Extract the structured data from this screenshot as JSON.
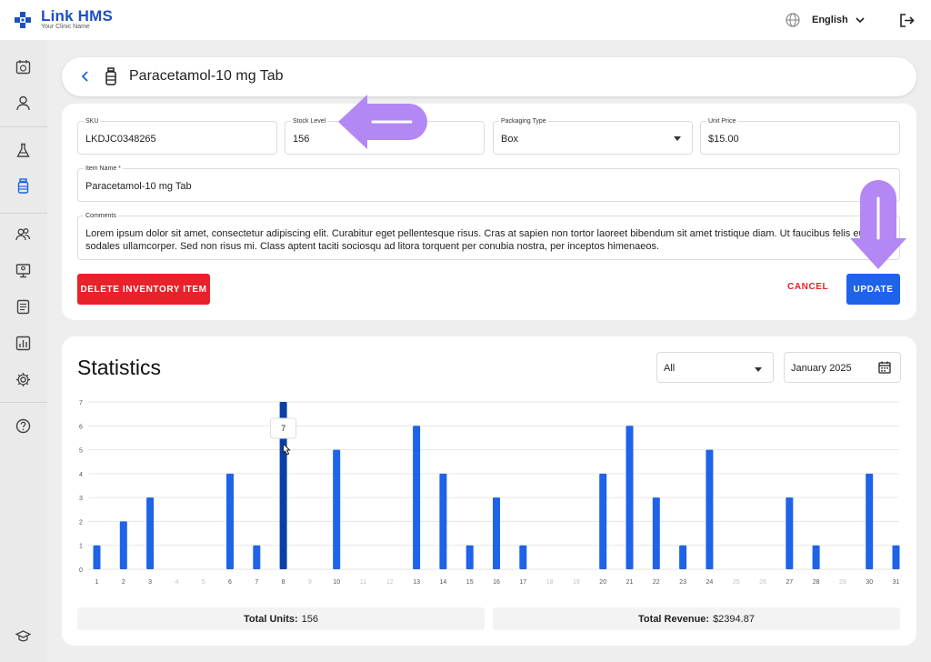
{
  "app": {
    "name": "Link HMS",
    "tagline": "Your Clinic Name"
  },
  "topbar": {
    "language": "English"
  },
  "sidebar": {
    "icons": [
      "appointments-icon",
      "patient-icon",
      "lab-icon",
      "inventory-icon",
      "staff-icon",
      "monitor-icon",
      "reports-icon",
      "analytics-icon",
      "settings-icon",
      "help-icon",
      "education-icon"
    ],
    "active": "inventory-icon"
  },
  "header": {
    "title": "Paracetamol-10 mg Tab"
  },
  "form": {
    "sku": {
      "label": "SKU",
      "value": "LKDJC0348265"
    },
    "stock": {
      "label": "Stock Level",
      "value": "156"
    },
    "packaging": {
      "label": "Packaging Type",
      "value": "Box"
    },
    "price": {
      "label": "Unit Price",
      "value": "$15.00"
    },
    "item_name": {
      "label": "Item Name *",
      "value": "Paracetamol-10 mg Tab"
    },
    "comments": {
      "label": "Comments",
      "value": "Lorem ipsum dolor sit amet, consectetur adipiscing elit. Curabitur eget pellentesque risus. Cras at sapien non tortor laoreet bibendum sit amet tristique diam. Ut faucibus felis eu sodales ullamcorper. Sed non risus mi. Class aptent taciti sociosqu ad litora torquent per conubia nostra, per inceptos himenaeos."
    },
    "delete_label": "DELETE INVENTORY ITEM",
    "cancel_label": "CANCEL",
    "update_label": "UPDATE"
  },
  "stats": {
    "title": "Statistics",
    "filter": "All",
    "period": "January 2025",
    "total_units_label": "Total Units:",
    "total_units": "156",
    "total_revenue_label": "Total Revenue:",
    "total_revenue": "$2394.87",
    "tooltip": "7"
  },
  "colors": {
    "accent": "#1e63e9",
    "bar": "#1f63e8",
    "bar_active": "#0b3fa8",
    "danger": "#e8212a",
    "annotation": "#b388f5"
  },
  "chart_data": {
    "type": "bar",
    "categories": [
      "1",
      "2",
      "3",
      "4",
      "5",
      "6",
      "7",
      "8",
      "9",
      "10",
      "11",
      "12",
      "13",
      "14",
      "15",
      "16",
      "17",
      "18",
      "19",
      "20",
      "21",
      "22",
      "23",
      "24",
      "25",
      "26",
      "27",
      "28",
      "29",
      "30",
      "31"
    ],
    "values": [
      1,
      2,
      3,
      0,
      0,
      4,
      1,
      7,
      0,
      5,
      0,
      0,
      6,
      4,
      1,
      3,
      1,
      0,
      0,
      4,
      6,
      3,
      1,
      5,
      0,
      0,
      3,
      1,
      0,
      4,
      1
    ],
    "ylim": [
      0,
      7
    ],
    "yticks": [
      "0",
      "1",
      "2",
      "3",
      "4",
      "5",
      "6",
      "7"
    ],
    "highlighted_category": "8",
    "grid": true
  }
}
